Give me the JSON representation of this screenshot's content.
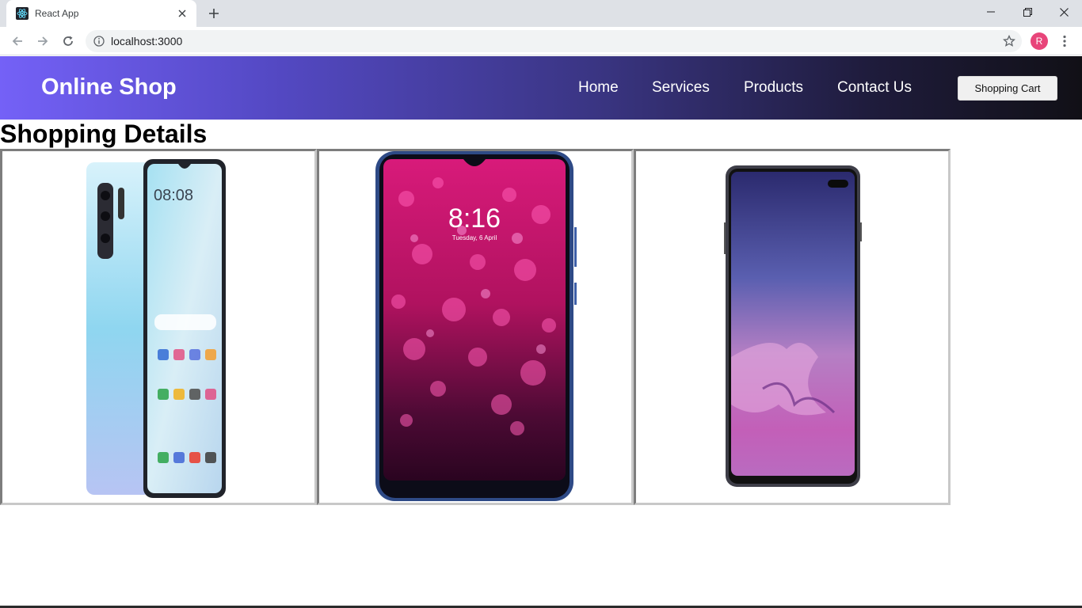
{
  "browser": {
    "tab_title": "React App",
    "url": "localhost:3000",
    "profile_initial": "R"
  },
  "header": {
    "brand": "Online Shop",
    "nav": [
      "Home",
      "Services",
      "Products",
      "Contact Us"
    ],
    "cart_label": "Shopping Cart"
  },
  "page": {
    "title": "Shopping Details"
  },
  "products": {
    "phone2_time": "8:16",
    "phone2_date": "Tuesday, 6 April",
    "phone1_time": "08:08"
  },
  "colors": {
    "header_gradient_start": "#7461f7",
    "header_gradient_end": "#111016",
    "profile": "#e8457a"
  }
}
